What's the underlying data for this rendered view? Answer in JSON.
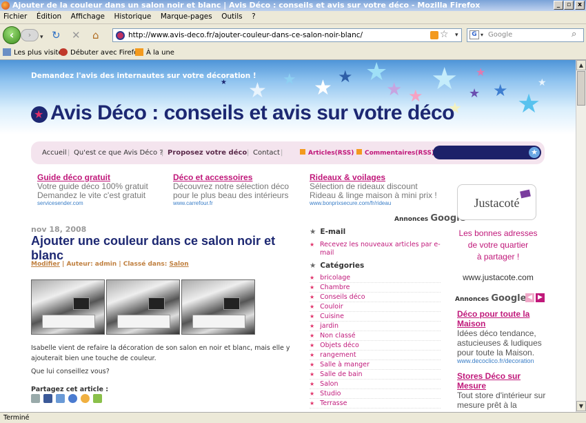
{
  "window": {
    "title": "Ajouter de la couleur dans un salon noir et blanc | Avis Déco : conseils et avis sur votre déco - Mozilla Firefox",
    "buttons": [
      "_",
      "▫",
      "x"
    ]
  },
  "menu": [
    "Fichier",
    "Édition",
    "Affichage",
    "Historique",
    "Marque-pages",
    "Outils",
    "?"
  ],
  "toolbar": {
    "url": "http://www.avis-deco.fr/ajouter-couleur-dans-ce-salon-noir-blanc/",
    "search_placeholder": "Google"
  },
  "bookmarks": [
    "Les plus visités",
    "Débuter avec Firefox",
    "À la une"
  ],
  "site": {
    "tagline": "Demandez l'avis des internautes sur votre décoration !",
    "title": "Avis Déco : conseils et avis sur votre déco",
    "nav": [
      "Accueil",
      "Qu'est ce que Avis Déco ?",
      "Proposez votre déco",
      "Contact"
    ],
    "feeds": [
      "Articles(RSS)",
      "Commentaires(RSS)"
    ]
  },
  "ads_top": [
    {
      "title": "Guide déco gratuit",
      "line1": "Votre guide déco 100% gratuit",
      "line2": "Demandez le vite c'est gratuit",
      "url": "servicesender.com"
    },
    {
      "title": "Déco et accessoires",
      "line1": "Découvrez notre sélection déco",
      "line2": "pour le plus beau des intérieurs",
      "url": "www.carrefour.fr"
    },
    {
      "title": "Rideaux & voilages",
      "line1": "Sélection de rideaux discount",
      "line2": "Rideau & linge maison à mini prix !",
      "url": "www.bonprixsecure.com/fr/rideau"
    }
  ],
  "ads_by": "Annonces",
  "ads_brand": "Google",
  "post": {
    "date": "nov 18, 2008",
    "title": "Ajouter une couleur dans ce salon noir et blanc",
    "meta_modify": "Modifier",
    "meta_author": " | Auteur: admin | Classé dans: ",
    "meta_category": "Salon",
    "para1": "Isabelle vient de refaire la décoration de son salon en noir et blanc, mais elle y ajouterait bien une touche de couleur.",
    "para2": "Que lui conseillez vous?",
    "share": "Partagez cet article :"
  },
  "sidebar": {
    "email_head": "E-mail",
    "email_desc": "Recevez les nouveaux articles par e-mail",
    "cat_head": "Catégories",
    "categories": [
      "bricolage",
      "Chambre",
      "Conseils déco",
      "Couloir",
      "Cuisine",
      "jardin",
      "Non classé",
      "Objets déco",
      "rangement",
      "Salle à manger",
      "Salle de bain",
      "Salon",
      "Studio",
      "Terrasse"
    ]
  },
  "justacote": {
    "logo": "Justacoté",
    "line1": "Les bonnes adresses",
    "line2": "de votre quartier",
    "line3": "à partager !",
    "url": "www.justacote.com"
  },
  "ads_right": [
    {
      "title": "Déco pour toute la Maison",
      "desc": "Idées déco tendance, astucieuses & ludiques pour toute la Maison.",
      "url": "www.decoclico.fr/decoration"
    },
    {
      "title": "Stores Déco sur Mesure",
      "desc": "Tout store d'intérieur sur mesure prêt à la"
    }
  ],
  "status": "Terminé",
  "colors": {
    "accent": "#c0187a",
    "navy": "#1d2872"
  }
}
